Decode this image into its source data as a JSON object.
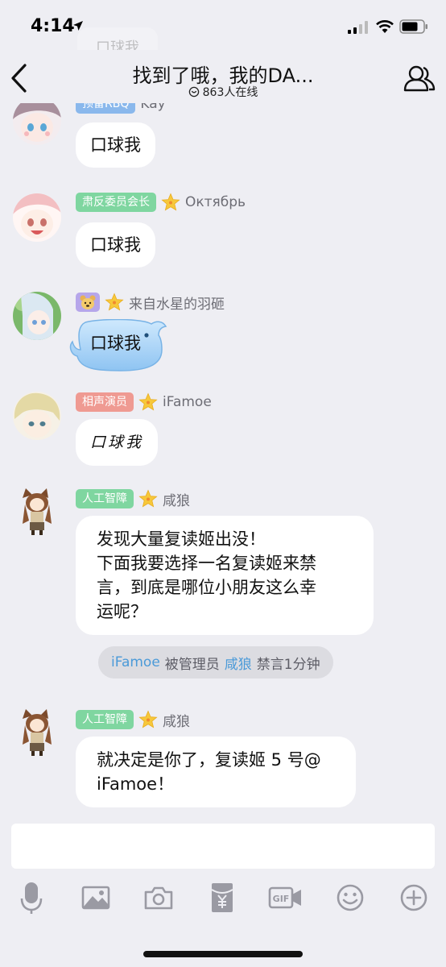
{
  "status_bar": {
    "time": "4:14"
  },
  "nav": {
    "title": "找到了哦，我的DA...",
    "online_text": "863人在线"
  },
  "ghost_message": {
    "text": "口球我"
  },
  "messages": [
    {
      "badge": "预备RBQ",
      "sender": "Kay",
      "text": "口球我"
    },
    {
      "badge": "肃反委员会长",
      "sender": "Октябрь",
      "text": "口球我"
    },
    {
      "sender": "来自水星的羽砸",
      "text": "口球我"
    },
    {
      "badge": "相声演员",
      "sender": "iFamoe",
      "text": "口球我"
    },
    {
      "badge": "人工智障",
      "sender": "咸狼",
      "text_lines": [
        "发现大量复读姬出没！",
        "下面我要选择一名复读姬来禁",
        "言，到底是哪位小朋友这么幸",
        "运呢？"
      ]
    },
    {
      "badge": "人工智障",
      "sender": "咸狼",
      "text_lines": [
        "就决定是你了，复读姬 5 号@",
        "iFamoe！"
      ]
    }
  ],
  "system_notice": {
    "target": "iFamoe",
    "middle": "被管理员",
    "admin": "咸狼",
    "action": "禁言1分钟"
  },
  "colors": {
    "background": "#eeeef3",
    "badge_green": "#7fd6a0",
    "badge_blue": "#8ab8ec",
    "badge_red": "#ef9a92",
    "link_blue": "#4b9ad8"
  },
  "toolbar_icons": [
    "microphone-icon",
    "image-icon",
    "camera-icon",
    "red-packet-icon",
    "gif-icon",
    "emoji-icon",
    "plus-icon"
  ]
}
